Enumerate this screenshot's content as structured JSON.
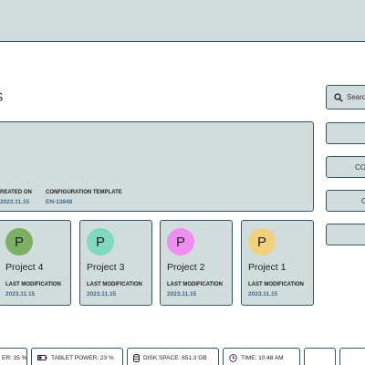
{
  "header": {
    "title": ""
  },
  "main": {
    "heading": "S"
  },
  "actions": {
    "search_label": "Searc",
    "button2_label": "",
    "button3_label": "CO",
    "button4_label": "C",
    "button5_label": ""
  },
  "details": {
    "created_label": "REATED ON",
    "created_value": "2023.11.15",
    "template_label": "CONFIGURATION TEMPLATE",
    "template_value": "EN-13848"
  },
  "projects": [
    {
      "initial": "P",
      "name": "Project 4",
      "mod_label": "LAST MODIFICATION",
      "mod_date": "2023.11.15",
      "color": "#7cb062"
    },
    {
      "initial": "P",
      "name": "Project 3",
      "mod_label": "LAST MODIFICATION",
      "mod_date": "2023.11.15",
      "color": "#7fd8c0"
    },
    {
      "initial": "P",
      "name": "Project 2",
      "mod_label": "LAST MODIFICATION",
      "mod_date": "2023.11.15",
      "color": "#ef8ef0"
    },
    {
      "initial": "P",
      "name": "Project 1",
      "mod_label": "LAST MODIFICATION",
      "mod_date": "2023.11.15",
      "color": "#f1d27c"
    }
  ],
  "status": {
    "power": "ER: 35 %",
    "tablet_power": "TABLET POWER: 23 %",
    "disk_space": "DISK SPACE: 651.3 GB",
    "time": "TIME: 10:48 AM"
  },
  "colors": {
    "panel_bg": "#d1dcdc",
    "border": "#355565",
    "accent_text": "#3f6a8a"
  },
  "icons": {
    "search": "magnifier-icon",
    "tablet": "tablet-battery-icon",
    "disk": "disk-icon",
    "time": "clock-icon"
  }
}
